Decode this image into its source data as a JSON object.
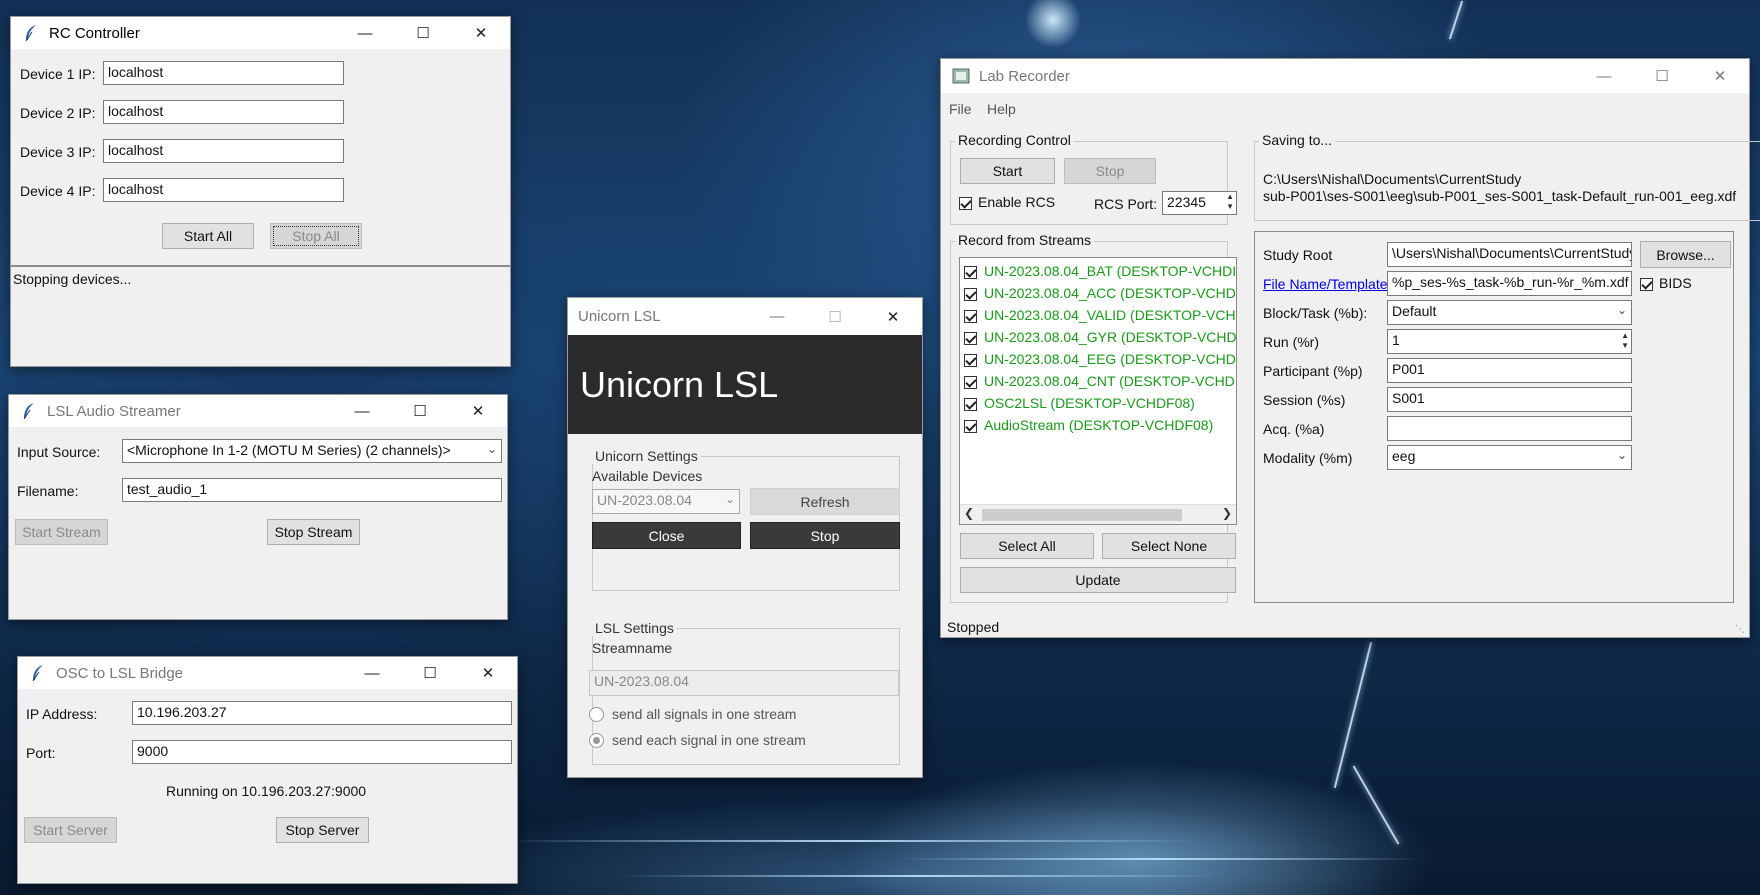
{
  "rc": {
    "title": "RC Controller",
    "fields": [
      {
        "label": "Device 1 IP:",
        "value": "localhost"
      },
      {
        "label": "Device 2 IP:",
        "value": "localhost"
      },
      {
        "label": "Device 3 IP:",
        "value": "localhost"
      },
      {
        "label": "Device 4 IP:",
        "value": "localhost"
      }
    ],
    "start_all": "Start All",
    "stop_all": "Stop All",
    "status": "Stopping devices..."
  },
  "audio": {
    "title": "LSL Audio Streamer",
    "input_label": "Input Source:",
    "input_value": "<Microphone In 1-2 (MOTU M Series) (2 channels)>",
    "filename_label": "Filename:",
    "filename_value": "test_audio_1",
    "start_stream": "Start Stream",
    "stop_stream": "Stop Stream"
  },
  "osc": {
    "title": "OSC to LSL Bridge",
    "ip_label": "IP Address:",
    "ip_value": "10.196.203.27",
    "port_label": "Port:",
    "port_value": "9000",
    "status": "Running on 10.196.203.27:9000",
    "start_server": "Start Server",
    "stop_server": "Stop Server"
  },
  "unicorn": {
    "title": "Unicorn LSL",
    "header": "Unicorn LSL",
    "settings_title": "Unicorn Settings",
    "available_devices": "Available Devices",
    "device_value": "UN-2023.08.04",
    "refresh": "Refresh",
    "close": "Close",
    "stop": "Stop",
    "lsl_title": "LSL Settings",
    "streamname_label": "Streamname",
    "streamname_value": "UN-2023.08.04",
    "radio_all": "send all signals in one stream",
    "radio_each": "send each signal in one stream"
  },
  "lab": {
    "title": "Lab Recorder",
    "menu": {
      "file": "File",
      "help": "Help"
    },
    "recording_control": "Recording Control",
    "start": "Start",
    "stop": "Stop",
    "enable_rcs": "Enable RCS",
    "rcs_port_label": "RCS Port:",
    "rcs_port_value": "22345",
    "record_from_streams": "Record from Streams",
    "streams": [
      "UN-2023.08.04_BAT (DESKTOP-VCHDI",
      "UN-2023.08.04_ACC (DESKTOP-VCHD",
      "UN-2023.08.04_VALID (DESKTOP-VCH",
      "UN-2023.08.04_GYR (DESKTOP-VCHDI",
      "UN-2023.08.04_EEG (DESKTOP-VCHDI",
      "UN-2023.08.04_CNT (DESKTOP-VCHD",
      "OSC2LSL (DESKTOP-VCHDF08)",
      "AudioStream (DESKTOP-VCHDF08)"
    ],
    "select_all": "Select All",
    "select_none": "Select None",
    "update": "Update",
    "saving_to": "Saving to...",
    "save_path_1": "C:\\Users\\Nishal\\Documents\\CurrentStudy",
    "save_path_2": "sub-P001\\ses-S001\\eeg\\sub-P001_ses-S001_task-Default_run-001_eeg.xdf",
    "study_root_label": "Study Root",
    "study_root_value": "\\Users\\Nishal\\Documents\\CurrentStudy",
    "browse": "Browse...",
    "file_template_link": "File Name/Template",
    "file_template_value": "%p_ses-%s_task-%b_run-%r_%m.xdf",
    "bids": "BIDS",
    "block_label": "Block/Task (%b):",
    "block_value": "Default",
    "run_label": "Run (%r)",
    "run_value": "1",
    "participant_label": "Participant (%p)",
    "participant_value": "P001",
    "session_label": "Session (%s)",
    "session_value": "S001",
    "acq_label": "Acq. (%a)",
    "acq_value": "",
    "modality_label": "Modality (%m)",
    "modality_value": "eeg",
    "status": "Stopped"
  },
  "colors": {
    "stream_green": "#1a9a1a",
    "link_blue": "#0000ee",
    "unicorn_header": "#2b2b2b",
    "dark_button": "#3a3a3a"
  }
}
